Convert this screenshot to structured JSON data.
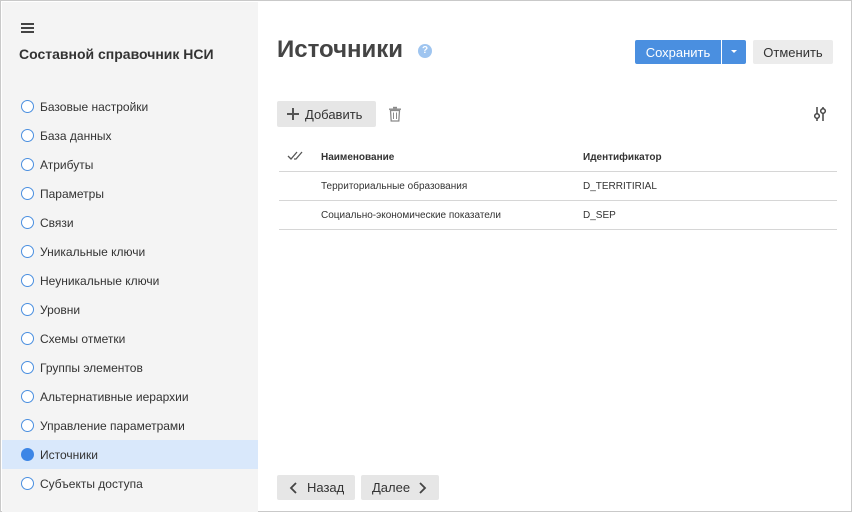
{
  "app": {
    "title": "Составной справочник НСИ"
  },
  "sidebar": {
    "items": [
      {
        "label": "Базовые настройки"
      },
      {
        "label": "База данных"
      },
      {
        "label": "Атрибуты"
      },
      {
        "label": "Параметры"
      },
      {
        "label": "Связи"
      },
      {
        "label": "Уникальные ключи"
      },
      {
        "label": "Неуникальные ключи"
      },
      {
        "label": "Уровни"
      },
      {
        "label": "Схемы отметки"
      },
      {
        "label": "Группы элементов"
      },
      {
        "label": "Альтернативные иерархии"
      },
      {
        "label": "Управление параметрами"
      },
      {
        "label": "Источники"
      },
      {
        "label": "Субъекты доступа"
      }
    ],
    "active_index": 12
  },
  "page": {
    "title": "Источники",
    "help_glyph": "?"
  },
  "toolbar": {
    "save_label": "Сохранить",
    "cancel_label": "Отменить",
    "add_label": "Добавить"
  },
  "table": {
    "headers": {
      "name": "Наименование",
      "id": "Идентификатор"
    },
    "rows": [
      {
        "name": "Территориальные образования",
        "id": "D_TERRITIRIAL"
      },
      {
        "name": "Социально-экономические показатели",
        "id": "D_SEP"
      }
    ]
  },
  "footer": {
    "back_label": "Назад",
    "next_label": "Далее"
  },
  "colors": {
    "accent": "#4a8fe0",
    "active_bg": "#d9e8fb",
    "sidebar_bg": "#f4f4f4"
  },
  "icons": {
    "menu": "hamburger-menu-icon",
    "help": "help-icon",
    "add": "plus-icon",
    "delete": "trash-icon",
    "settings": "filter-settings-icon",
    "select_all": "double-check-icon",
    "back": "chevron-left-icon",
    "next": "chevron-right-icon"
  }
}
